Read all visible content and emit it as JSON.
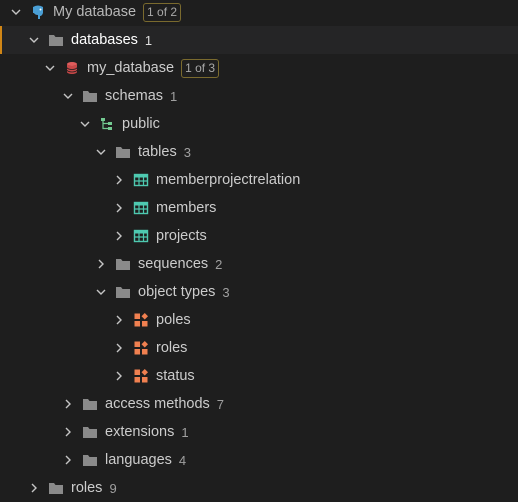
{
  "colors": {
    "background": "#1e1e1e",
    "selected_background": "#252526",
    "selected_accent": "#d18616",
    "folder": "#8a8a8a",
    "database_icon": "#e05c5c",
    "table_icon": "#4ec9b0",
    "type_icon": "#f08050",
    "schema_icon": "#73c991",
    "server_icon": "#4a9fd5",
    "badge_border": "#7a6a2e"
  },
  "tree": {
    "connection": {
      "label": "My database",
      "badge": "1 of 2",
      "icon": "postgres-elephant-icon"
    },
    "databases": {
      "label": "databases",
      "count": "1"
    },
    "my_database": {
      "label": "my_database",
      "badge": "1 of 3",
      "icon": "database-cylinder-icon"
    },
    "schemas": {
      "label": "schemas",
      "count": "1"
    },
    "public": {
      "label": "public",
      "icon": "schema-icon"
    },
    "tables": {
      "label": "tables",
      "count": "3"
    },
    "table_items": [
      {
        "label": "memberprojectrelation",
        "icon": "table-icon"
      },
      {
        "label": "members",
        "icon": "table-icon"
      },
      {
        "label": "projects",
        "icon": "table-icon"
      }
    ],
    "sequences": {
      "label": "sequences",
      "count": "2"
    },
    "object_types": {
      "label": "object types",
      "count": "3"
    },
    "type_items": [
      {
        "label": "poles",
        "icon": "object-type-icon"
      },
      {
        "label": "roles",
        "icon": "object-type-icon"
      },
      {
        "label": "status",
        "icon": "object-type-icon"
      }
    ],
    "access_methods": {
      "label": "access methods",
      "count": "7"
    },
    "extensions": {
      "label": "extensions",
      "count": "1"
    },
    "languages": {
      "label": "languages",
      "count": "4"
    },
    "roles": {
      "label": "roles",
      "count": "9"
    }
  }
}
